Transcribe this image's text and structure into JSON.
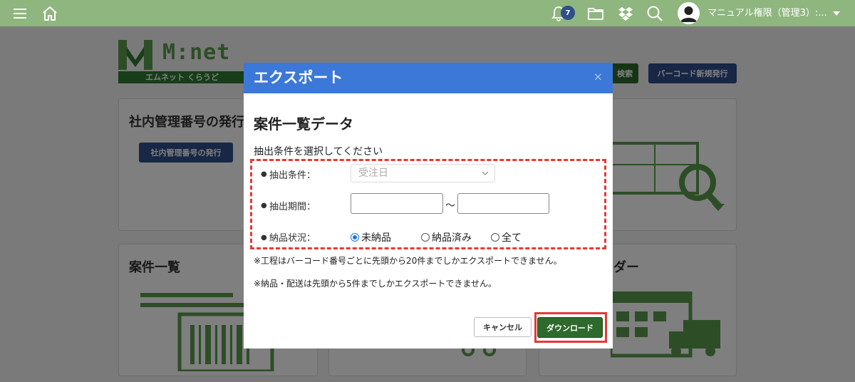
{
  "topbar": {
    "notification_count": "7",
    "user_name": "マニュアル権限（管理3）:..."
  },
  "logo": {
    "text": "M:net",
    "subtitle": "エムネット くらうど"
  },
  "header_buttons": {
    "search": "検索",
    "barcode_issue": "バーコード新規発行"
  },
  "cards": {
    "internal_number": {
      "title": "社内管理番号の発行",
      "button": "社内管理番号の発行"
    },
    "case_list": {
      "title": "案件一覧"
    },
    "calendar": {
      "title": "ンダー"
    }
  },
  "modal": {
    "title": "エクスポート",
    "close": "×",
    "section_title": "案件一覧データ",
    "instruction": "抽出条件を選択してください",
    "condition_label": "抽出条件：",
    "condition_value": "受注日",
    "period_label": "抽出期間：",
    "period_start": "",
    "period_end": "",
    "period_separator": "〜",
    "delivery_label": "納品状況：",
    "delivery_options": [
      "未納品",
      "納品済み",
      "全て"
    ],
    "delivery_selected": "未納品",
    "note1": "※工程はバーコード番号ごとに先頭から20件までしかエクスポートできません。",
    "note2": "※納品・配送は先頭から5件までしかエクスポートできません。",
    "cancel": "キャンセル",
    "download": "ダウンロード"
  },
  "colors": {
    "topbar": "#8fb67e",
    "modal_header": "#3c78d8",
    "download_button": "#2e6a2b",
    "highlight": "#e53935",
    "badge": "#2f4f8a"
  }
}
